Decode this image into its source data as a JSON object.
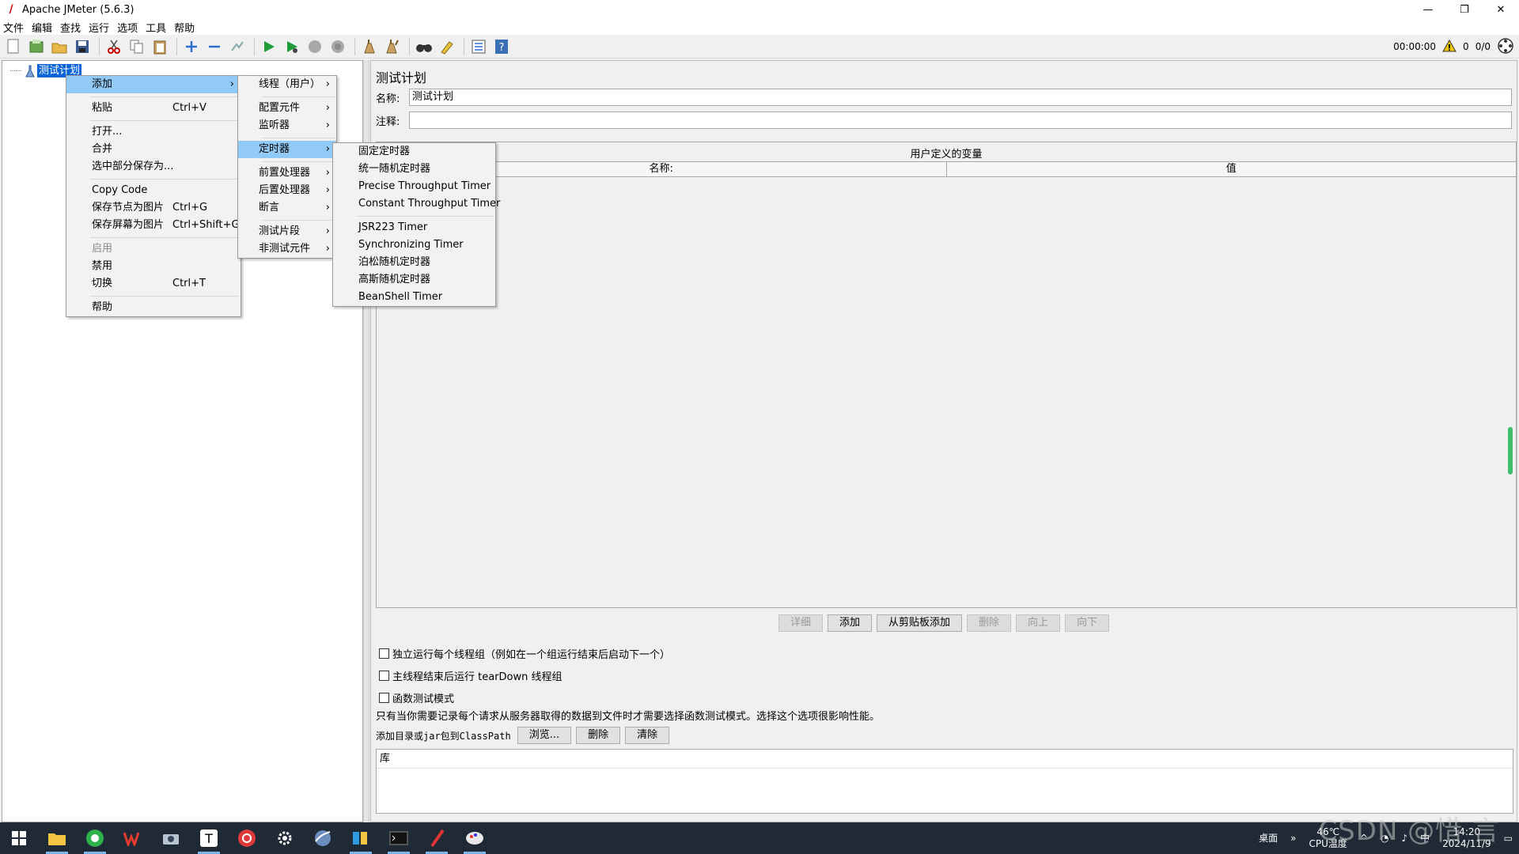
{
  "window": {
    "title": "Apache JMeter (5.6.3)",
    "controls": [
      "—",
      "❐",
      "✕"
    ]
  },
  "menubar": [
    "文件",
    "编辑",
    "查找",
    "运行",
    "选项",
    "工具",
    "帮助"
  ],
  "toolbar": {
    "timer": "00:00:00",
    "warnings": "0",
    "threads": "0/0"
  },
  "tree": {
    "root_label": "测试计划"
  },
  "right_panel": {
    "title": "测试计划",
    "name_label": "名称:",
    "name_value": "测试计划",
    "comment_label": "注释:",
    "comment_value": "",
    "vars_caption": "用户定义的变量",
    "vars_columns": [
      "名称:",
      "值"
    ],
    "buttons": [
      {
        "label": "详细",
        "disabled": true
      },
      {
        "label": "添加",
        "disabled": false
      },
      {
        "label": "从剪贴板添加",
        "disabled": false
      },
      {
        "label": "删除",
        "disabled": true
      },
      {
        "label": "向上",
        "disabled": true
      },
      {
        "label": "向下",
        "disabled": true
      }
    ],
    "checkboxes": [
      "独立运行每个线程组（例如在一个组运行结束后启动下一个）",
      "主线程结束后运行 tearDown 线程组",
      "函数测试模式"
    ],
    "note": "只有当你需要记录每个请求从服务器取得的数据到文件时才需要选择函数测试模式。选择这个选项很影响性能。",
    "classpath_label": "添加目录或jar包到ClassPath",
    "classpath_buttons": [
      "浏览...",
      "删除",
      "清除"
    ],
    "lib_header": "库"
  },
  "context_menu": {
    "items": [
      {
        "label": "添加",
        "shortcut": "",
        "submenu": true,
        "highlight": true,
        "disabled": false
      },
      {
        "sep": true
      },
      {
        "label": "粘贴",
        "shortcut": "Ctrl+V",
        "submenu": false,
        "highlight": false,
        "disabled": false
      },
      {
        "sep": true
      },
      {
        "label": "打开...",
        "shortcut": "",
        "submenu": false,
        "highlight": false,
        "disabled": false
      },
      {
        "label": "合并",
        "shortcut": "",
        "submenu": false,
        "highlight": false,
        "disabled": false
      },
      {
        "label": "选中部分保存为...",
        "shortcut": "",
        "submenu": false,
        "highlight": false,
        "disabled": false
      },
      {
        "sep": true
      },
      {
        "label": "Copy Code",
        "shortcut": "",
        "submenu": false,
        "highlight": false,
        "disabled": false
      },
      {
        "label": "保存节点为图片",
        "shortcut": "Ctrl+G",
        "submenu": false,
        "highlight": false,
        "disabled": false
      },
      {
        "label": "保存屏幕为图片",
        "shortcut": "Ctrl+Shift+G",
        "submenu": false,
        "highlight": false,
        "disabled": false
      },
      {
        "sep": true
      },
      {
        "label": "启用",
        "shortcut": "",
        "submenu": false,
        "highlight": false,
        "disabled": true
      },
      {
        "label": "禁用",
        "shortcut": "",
        "submenu": false,
        "highlight": false,
        "disabled": false
      },
      {
        "label": "切换",
        "shortcut": "Ctrl+T",
        "submenu": false,
        "highlight": false,
        "disabled": false
      },
      {
        "sep": true
      },
      {
        "label": "帮助",
        "shortcut": "",
        "submenu": false,
        "highlight": false,
        "disabled": false
      }
    ]
  },
  "add_submenu": {
    "items": [
      {
        "label": "线程（用户）",
        "submenu": true,
        "highlight": false
      },
      {
        "sep": true
      },
      {
        "label": "配置元件",
        "submenu": true,
        "highlight": false
      },
      {
        "label": "监听器",
        "submenu": true,
        "highlight": false
      },
      {
        "sep": true
      },
      {
        "label": "定时器",
        "submenu": true,
        "highlight": true
      },
      {
        "sep": true
      },
      {
        "label": "前置处理器",
        "submenu": true,
        "highlight": false
      },
      {
        "label": "后置处理器",
        "submenu": true,
        "highlight": false
      },
      {
        "label": "断言",
        "submenu": true,
        "highlight": false
      },
      {
        "sep": true
      },
      {
        "label": "测试片段",
        "submenu": true,
        "highlight": false
      },
      {
        "label": "非测试元件",
        "submenu": true,
        "highlight": false
      }
    ]
  },
  "timer_submenu": {
    "items": [
      {
        "label": "固定定时器"
      },
      {
        "label": "统一随机定时器"
      },
      {
        "label": "Precise Throughput Timer"
      },
      {
        "label": "Constant Throughput Timer"
      },
      {
        "sep": true
      },
      {
        "label": "JSR223 Timer"
      },
      {
        "label": "Synchronizing Timer"
      },
      {
        "label": "泊松随机定时器"
      },
      {
        "label": "高斯随机定时器"
      },
      {
        "label": "BeanShell Timer"
      }
    ]
  },
  "taskbar": {
    "desktop_label": "桌面",
    "temp": "46℃",
    "temp_label": "CPU温度",
    "ime": "中",
    "time": "14:20",
    "date": "2024/11/9",
    "watermark": "CSDN @惜 言"
  },
  "colors": {
    "selection": "#0a64d8",
    "menu_highlight": "#91c9f7",
    "taskbar": "#1f2a36"
  }
}
